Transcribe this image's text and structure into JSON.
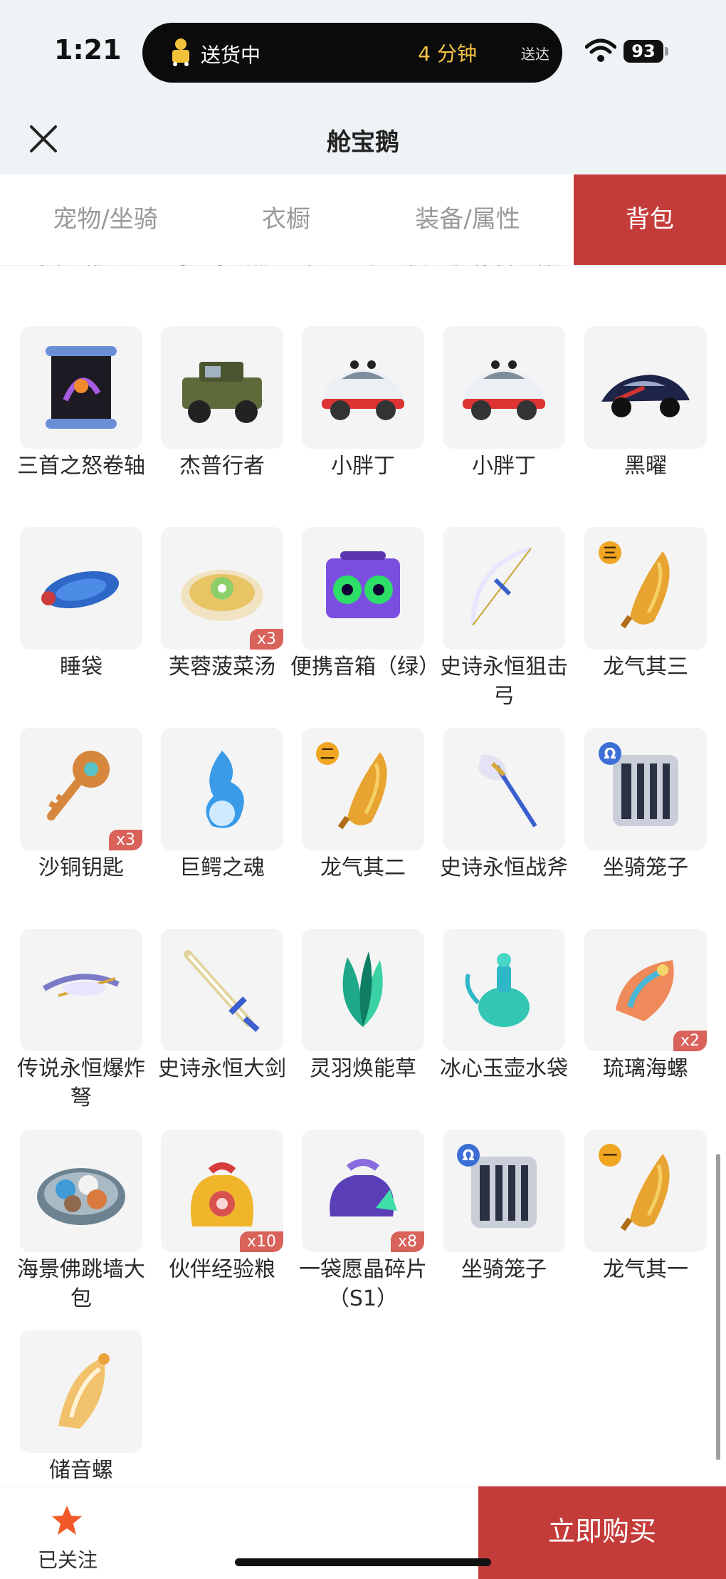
{
  "status_bar": {
    "time": "1:21",
    "delivery_text": "送货中",
    "eta_minutes": "4 分钟",
    "eta_label": "送达",
    "battery": "93"
  },
  "header": {
    "title": "舱宝鹅"
  },
  "tabs": [
    {
      "label": "宠物/坐骑",
      "active": false
    },
    {
      "label": "衣橱",
      "active": false
    },
    {
      "label": "装备/属性",
      "active": false
    },
    {
      "label": "背包",
      "active": true
    }
  ],
  "partial_row": [
    "海市蜃楼汤",
    "可爱小奶瓶",
    "未知星系法杖",
    "魔像召唤器",
    "睡袋"
  ],
  "items": [
    {
      "name": "三首之怒卷轴",
      "icon": "scroll-icon"
    },
    {
      "name": "杰普行者",
      "icon": "jeep-icon"
    },
    {
      "name": "小胖丁",
      "icon": "beetle-car-icon"
    },
    {
      "name": "小胖丁",
      "icon": "beetle-car-icon"
    },
    {
      "name": "黑曜",
      "icon": "sports-car-icon"
    },
    {
      "name": "睡袋",
      "icon": "sleeping-bag-icon"
    },
    {
      "name": "芙蓉菠菜汤",
      "icon": "soup-bowl-icon",
      "qty": "x3"
    },
    {
      "name": "便携音箱（绿）",
      "icon": "speaker-icon"
    },
    {
      "name": "史诗永恒狙击弓",
      "icon": "bow-icon"
    },
    {
      "name": "龙气其三",
      "icon": "dragon-claw-icon",
      "rank": "三"
    },
    {
      "name": "沙铜钥匙",
      "icon": "key-icon",
      "qty": "x3"
    },
    {
      "name": "巨鳄之魂",
      "icon": "blue-flame-icon"
    },
    {
      "name": "龙气其二",
      "icon": "dragon-claw-icon",
      "rank": "二"
    },
    {
      "name": "史诗永恒战斧",
      "icon": "axe-icon"
    },
    {
      "name": "坐骑笼子",
      "icon": "cage-icon",
      "rank": "Ω"
    },
    {
      "name": "传说永恒爆炸弩",
      "icon": "crossbow-icon"
    },
    {
      "name": "史诗永恒大剑",
      "icon": "sword-icon"
    },
    {
      "name": "灵羽焕能草",
      "icon": "green-leaf-icon"
    },
    {
      "name": "冰心玉壶水袋",
      "icon": "jade-kettle-icon"
    },
    {
      "name": "琉璃海螺",
      "icon": "conch-icon",
      "qty": "x2"
    },
    {
      "name": "海景佛跳墙大包",
      "icon": "bun-plate-icon"
    },
    {
      "name": "伙伴经验粮",
      "icon": "food-bag-icon",
      "qty": "x10"
    },
    {
      "name": "一袋愿晶碎片（S1）",
      "icon": "crystal-bag-icon",
      "qty": "x8"
    },
    {
      "name": "坐骑笼子",
      "icon": "cage-icon",
      "rank": "Ω"
    },
    {
      "name": "龙气其一",
      "icon": "dragon-claw-icon",
      "rank": "一"
    },
    {
      "name": "储音螺",
      "icon": "shell-horn-icon"
    }
  ],
  "bottom_bar": {
    "follow_label": "已关注",
    "buy_label": "立即购买"
  }
}
